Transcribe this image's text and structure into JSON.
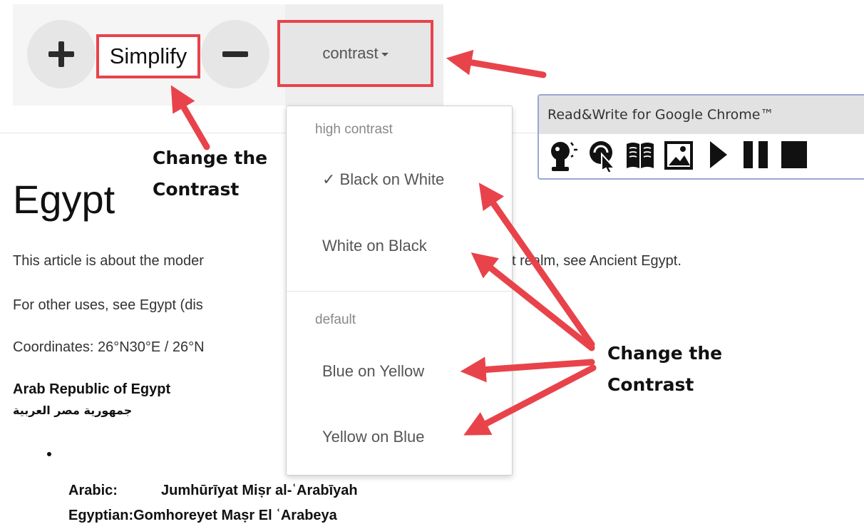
{
  "toolbar": {
    "zoom_in_label": "+",
    "simplify_label": "Simplify",
    "zoom_out_label": "−",
    "contrast_label": "contrast"
  },
  "contrast_menu": {
    "high_contrast_header": "high contrast",
    "black_on_white": "✓ Black on White",
    "white_on_black": "White on Black",
    "default_header": "default",
    "blue_on_yellow": "Blue on Yellow",
    "yellow_on_blue": "Yellow on Blue",
    "selected": "Black on White"
  },
  "readwrite": {
    "title": "Read&Write for Google Chrome™",
    "icons": [
      "speech-prediction-icon",
      "screenshot-reader-icon",
      "dictionary-icon",
      "picture-dictionary-icon",
      "play-icon",
      "pause-icon",
      "stop-icon"
    ]
  },
  "article": {
    "title": "Egypt",
    "para1_start": "This article is about the moder",
    "para1_end": "t realm, see Ancient Egypt.",
    "para2": "For other uses, see Egypt (dis",
    "para3": "Coordinates: 26°N30°E / 26°N",
    "country_name": "Arab Republic of Egypt",
    "country_arabic": "جمهورية مصر العربية",
    "names": [
      {
        "label": "Arabic:",
        "value": "Jumhūrīyat Miṣr al-ʿArabīyah"
      },
      {
        "label": "Egyptian:",
        "value": "Gomhoreyet Maṣr El ʿArabeya"
      }
    ]
  },
  "annotations": {
    "left_note": [
      "Change the",
      "Contrast"
    ],
    "right_note": [
      "Change the",
      "Contrast"
    ],
    "highlight_color": "#e8434b"
  }
}
